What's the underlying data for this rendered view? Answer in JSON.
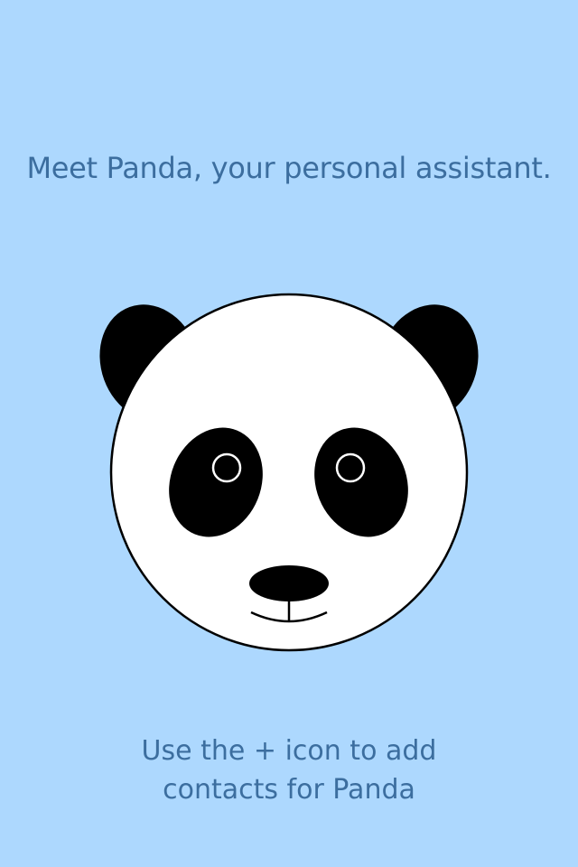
{
  "onboarding": {
    "headline": "Meet Panda, your personal assistant.",
    "hint_line_1": "Use the + icon to add",
    "hint_line_2": "contacts for Panda"
  },
  "colors": {
    "background": "#add8fe",
    "text": "#3c6e9f",
    "panda_fur": "#000000",
    "panda_face": "#ffffff"
  },
  "icons": {
    "mascot": "panda-face-icon"
  }
}
